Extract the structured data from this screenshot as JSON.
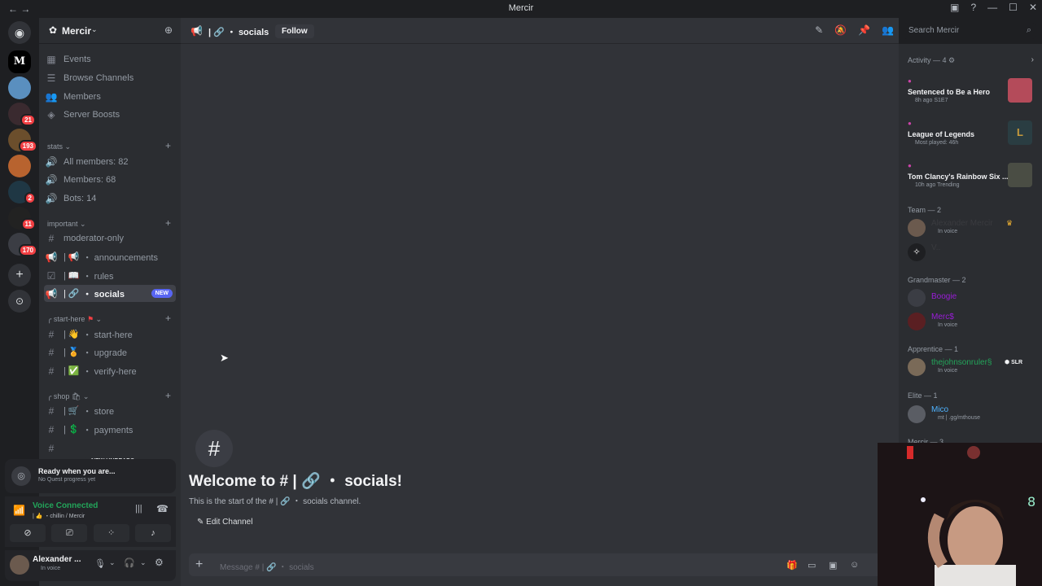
{
  "window": {
    "title": "Mercir"
  },
  "rail": {
    "badges": [
      "21",
      "193",
      "2",
      "11",
      "170"
    ]
  },
  "server": {
    "name": "Mercir"
  },
  "nav_items": [
    {
      "label": "Events",
      "icon": "calendar-icon"
    },
    {
      "label": "Browse Channels",
      "icon": "browse-icon"
    },
    {
      "label": "Members",
      "icon": "members-icon"
    },
    {
      "label": "Server Boosts",
      "icon": "boost-icon"
    }
  ],
  "categories": {
    "stats": "stats",
    "important": "important",
    "start_here": "start-here",
    "shop": "shop"
  },
  "stats_channels": [
    "All members: 82",
    "Members: 68",
    "Bots: 14"
  ],
  "important_channels": [
    {
      "prefix": "#",
      "label": "moderator-only"
    },
    {
      "prefix": "| 📢",
      "label": "・ announcements"
    },
    {
      "prefix": "| 📖",
      "label": "・ rules"
    },
    {
      "prefix": "| 🔗",
      "label": "・ socials",
      "badge": "NEW"
    }
  ],
  "start_channels": [
    {
      "prefix": "| 👋",
      "label": "・ start-here"
    },
    {
      "prefix": "| 🏅",
      "label": "・ upgrade"
    },
    {
      "prefix": "| ✅",
      "label": "・ verify-here"
    }
  ],
  "shop_channels": [
    {
      "prefix": "| 🛒",
      "label": "・ store"
    },
    {
      "prefix": "| 💲",
      "label": "・ payments"
    }
  ],
  "new_unreads": "NEW UNREADS",
  "quest": {
    "title": "Ready when you are...",
    "subtitle": "No Quest progress yet"
  },
  "voice": {
    "status": "Voice Connected",
    "channel": "| 👍 ・chillin / Mercir"
  },
  "user": {
    "name": "Alexander ...",
    "status": "In voice"
  },
  "topbar": {
    "channel": "| 🔗 ・ socials",
    "follow": "Follow",
    "search_placeholder": "Search Mercir"
  },
  "welcome": {
    "title": "Welcome to # | 🔗 ・ socials!",
    "subtitle": "This is the start of the # | 🔗 ・ socials channel.",
    "edit": "Edit Channel"
  },
  "composer": {
    "placeholder": "Message # | 🔗 ・ socials"
  },
  "members": {
    "activity_header": "Activity — 4",
    "activities": [
      {
        "title": "Sentenced to Be a Hero",
        "sub": "8h ago  S1E7"
      },
      {
        "title": "League of Legends",
        "sub": "Most played: 46h"
      },
      {
        "title": "Tom Clancy's Rainbow Six ...",
        "sub": "10h ago  Trending"
      }
    ],
    "groups": [
      {
        "header": "Team — 2"
      },
      {
        "header": "Grandmaster — 2"
      },
      {
        "header": "Apprentice — 1"
      },
      {
        "header": "Elite — 1"
      },
      {
        "header": "Mercir — 3"
      }
    ],
    "team": [
      {
        "name": "Alexander Mercir",
        "status": "In voice"
      },
      {
        "name": "V..",
        "status": ""
      }
    ],
    "grandmaster": [
      {
        "name": "Boogie",
        "status": ""
      },
      {
        "name": "Merc$",
        "status": "In voice"
      }
    ],
    "apprentice": [
      {
        "name": "thejohnsonruler§",
        "tag": "SLR",
        "status": "In voice"
      }
    ],
    "elite": [
      {
        "name": "Mico",
        "status": "mt | .gg/mthouse"
      }
    ]
  },
  "colors": {
    "accent": "#5865f2",
    "green": "#23a55a",
    "red": "#f23f43"
  }
}
